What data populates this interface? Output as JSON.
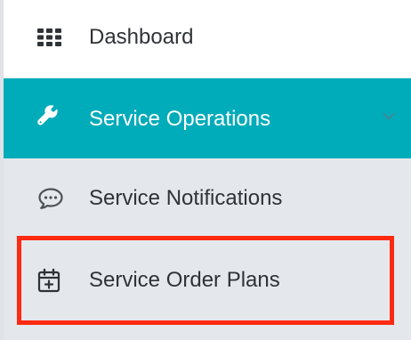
{
  "menu": {
    "dashboard": {
      "label": "Dashboard",
      "icon": "grid-icon"
    },
    "service_operations": {
      "label": "Service Operations",
      "icon": "wrench-icon",
      "expanded": true
    },
    "submenu": [
      {
        "label": "Service Notifications",
        "icon": "chat-bubble-icon"
      },
      {
        "label": "Service Order Plans",
        "icon": "calendar-plus-icon",
        "highlighted": true
      }
    ]
  },
  "colors": {
    "active_bg": "#00abba",
    "submenu_bg": "#e4e8ec",
    "text": "#2f3337",
    "highlight_border": "#ff2a12"
  }
}
